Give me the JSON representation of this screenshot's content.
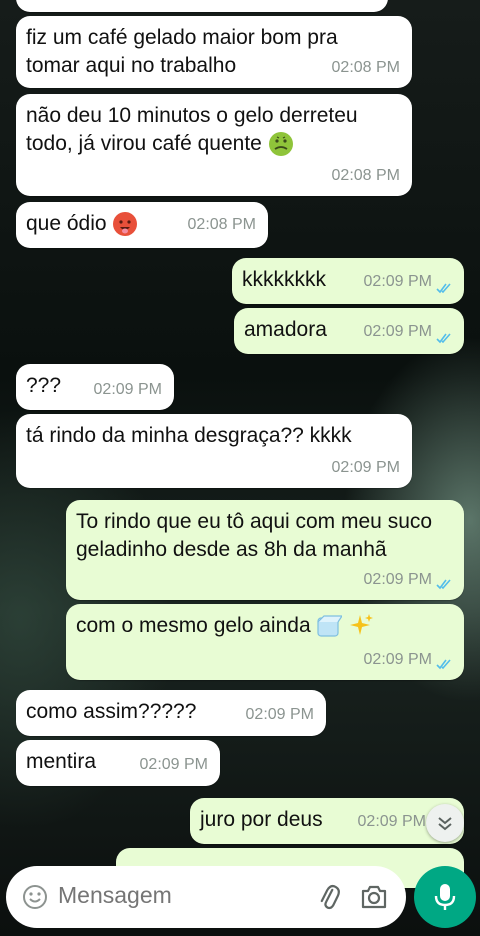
{
  "messages": [
    {
      "dir": "in",
      "text": "",
      "time": ""
    },
    {
      "dir": "in",
      "text": "fiz um café gelado maior bom pra tomar aqui no trabalho",
      "time": "02:08 PM"
    },
    {
      "dir": "in",
      "text": "não deu 10 minutos o gelo derreteu todo, já virou café quente",
      "emoji": "nauseated-face",
      "time": "02:08 PM"
    },
    {
      "dir": "in",
      "text": "que ódio",
      "emoji": "hot-face",
      "time": "02:08 PM"
    },
    {
      "dir": "out",
      "text": "kkkkkkkk",
      "time": "02:09 PM",
      "status": "read"
    },
    {
      "dir": "out",
      "text": "amadora",
      "time": "02:09 PM",
      "status": "read"
    },
    {
      "dir": "in",
      "text": "???",
      "time": "02:09 PM"
    },
    {
      "dir": "in",
      "text": "tá rindo da minha desgraça?? kkkk",
      "time": "02:09 PM"
    },
    {
      "dir": "out",
      "text": "To rindo que eu tô aqui com meu suco geladinho desde as 8h da manhã",
      "time": "02:09 PM",
      "status": "read"
    },
    {
      "dir": "out",
      "text": "com o mesmo gelo ainda",
      "emoji": "ice-cube sparkles",
      "time": "02:09 PM",
      "status": "read"
    },
    {
      "dir": "in",
      "text": "como assim?????",
      "time": "02:09 PM"
    },
    {
      "dir": "in",
      "text": "mentira",
      "time": "02:09 PM"
    },
    {
      "dir": "out",
      "text": "juro por deus",
      "time": "02:09 PM",
      "status": "read"
    }
  ],
  "composer": {
    "placeholder": "Mensagem",
    "emoji_icon": "emoji-icon",
    "attach_icon": "paperclip-icon",
    "camera_icon": "camera-icon",
    "mic_icon": "microphone-icon"
  },
  "scroll_down_icon": "double-chevron-down-icon",
  "colors": {
    "incoming_bubble": "#ffffff",
    "outgoing_bubble": "#e8fcd4",
    "read_ticks": "#53bdeb",
    "mic_button": "#00a884",
    "timestamp": "#8b9490"
  }
}
